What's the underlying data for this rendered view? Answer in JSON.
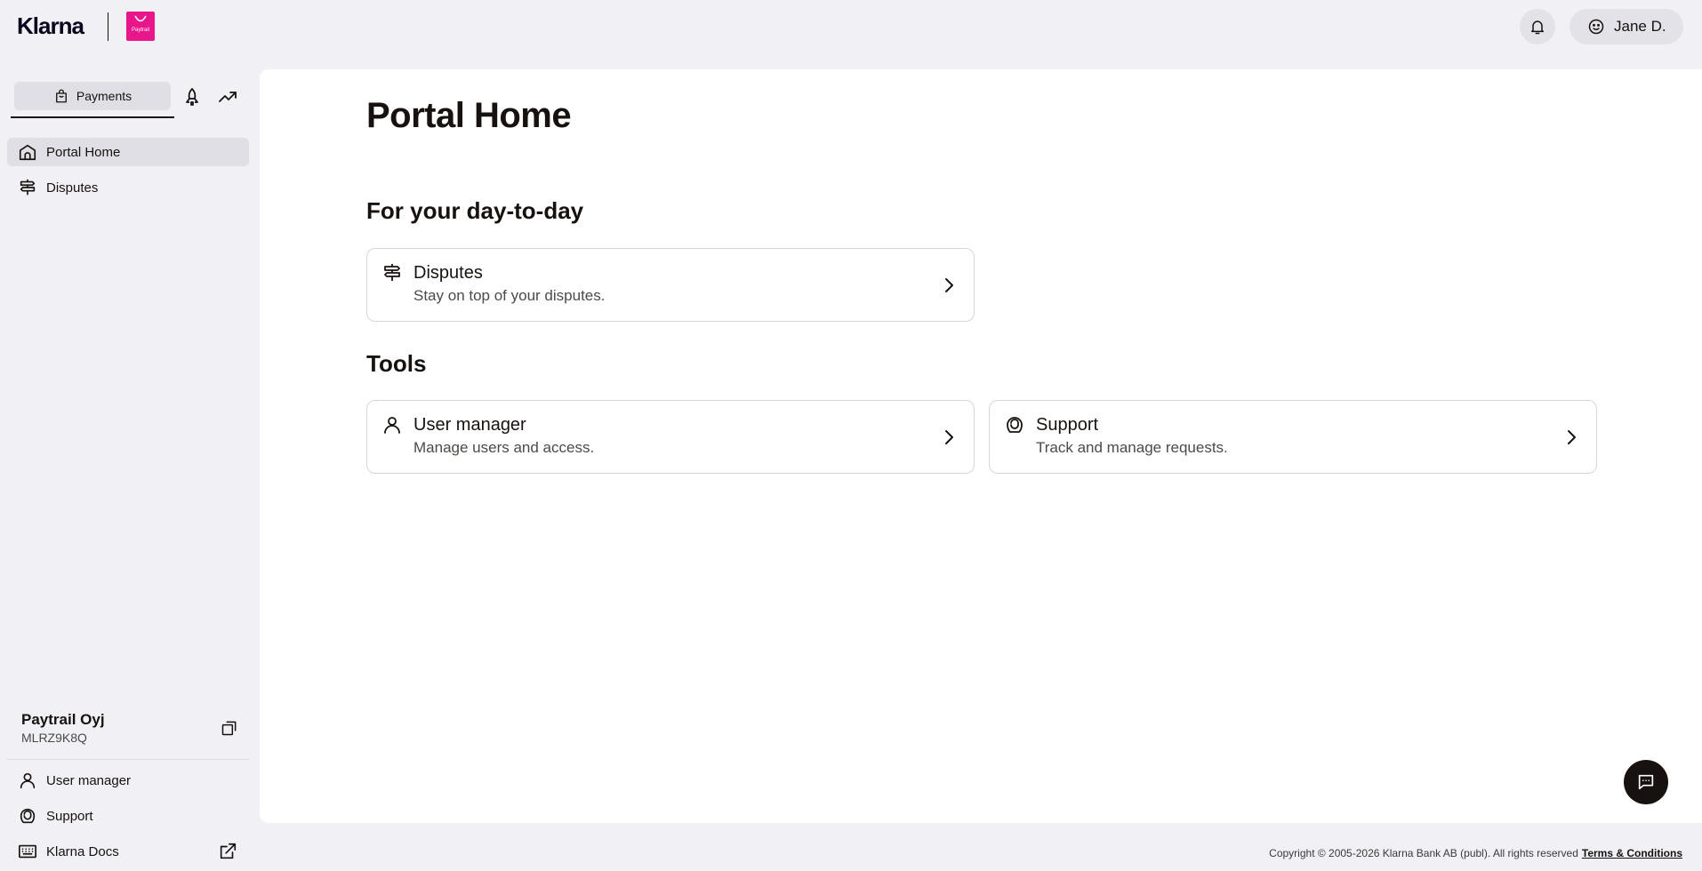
{
  "header": {
    "brand": "Klarna",
    "merchant_logo_text": "Paytrail",
    "user_name": "Jane D.",
    "icons": {
      "notifications": "bell-icon",
      "user": "smiley-face-icon"
    }
  },
  "sidebar": {
    "tabs": [
      {
        "label": "Payments",
        "icon": "shopping-bag-icon",
        "selected": true
      },
      {
        "label": "",
        "icon": "rocket-icon"
      },
      {
        "label": "",
        "icon": "trending-up-icon"
      }
    ],
    "nav": [
      {
        "label": "Portal Home",
        "icon": "home-icon",
        "active": true
      },
      {
        "label": "Disputes",
        "icon": "signpost-icon"
      }
    ],
    "store": {
      "name": "Paytrail Oyj",
      "id": "MLRZ9K8Q"
    },
    "bottom_nav": [
      {
        "label": "User manager",
        "icon": "person-icon"
      },
      {
        "label": "Support",
        "icon": "support-icon"
      },
      {
        "label": "Klarna Docs",
        "icon": "keyboard-icon",
        "external": true
      }
    ]
  },
  "main": {
    "title": "Portal Home",
    "sections": [
      {
        "title": "For your day-to-day",
        "cards": [
          {
            "title": "Disputes",
            "subtitle": "Stay on top of your disputes.",
            "icon": "signpost-icon"
          }
        ]
      },
      {
        "title": "Tools",
        "cards": [
          {
            "title": "User manager",
            "subtitle": "Manage users and access.",
            "icon": "person-icon"
          },
          {
            "title": "Support",
            "subtitle": "Track and manage requests.",
            "icon": "support-icon"
          }
        ]
      }
    ]
  },
  "footer": {
    "copyright": "Copyright © 2005-2026 Klarna Bank AB (publ). All rights reserved",
    "terms_link": "Terms & Conditions"
  },
  "colors": {
    "page_bg": "#f1f0f5",
    "panel_bg": "#ffffff",
    "merchant_pink": "#e8168a",
    "text": "#17120f"
  }
}
